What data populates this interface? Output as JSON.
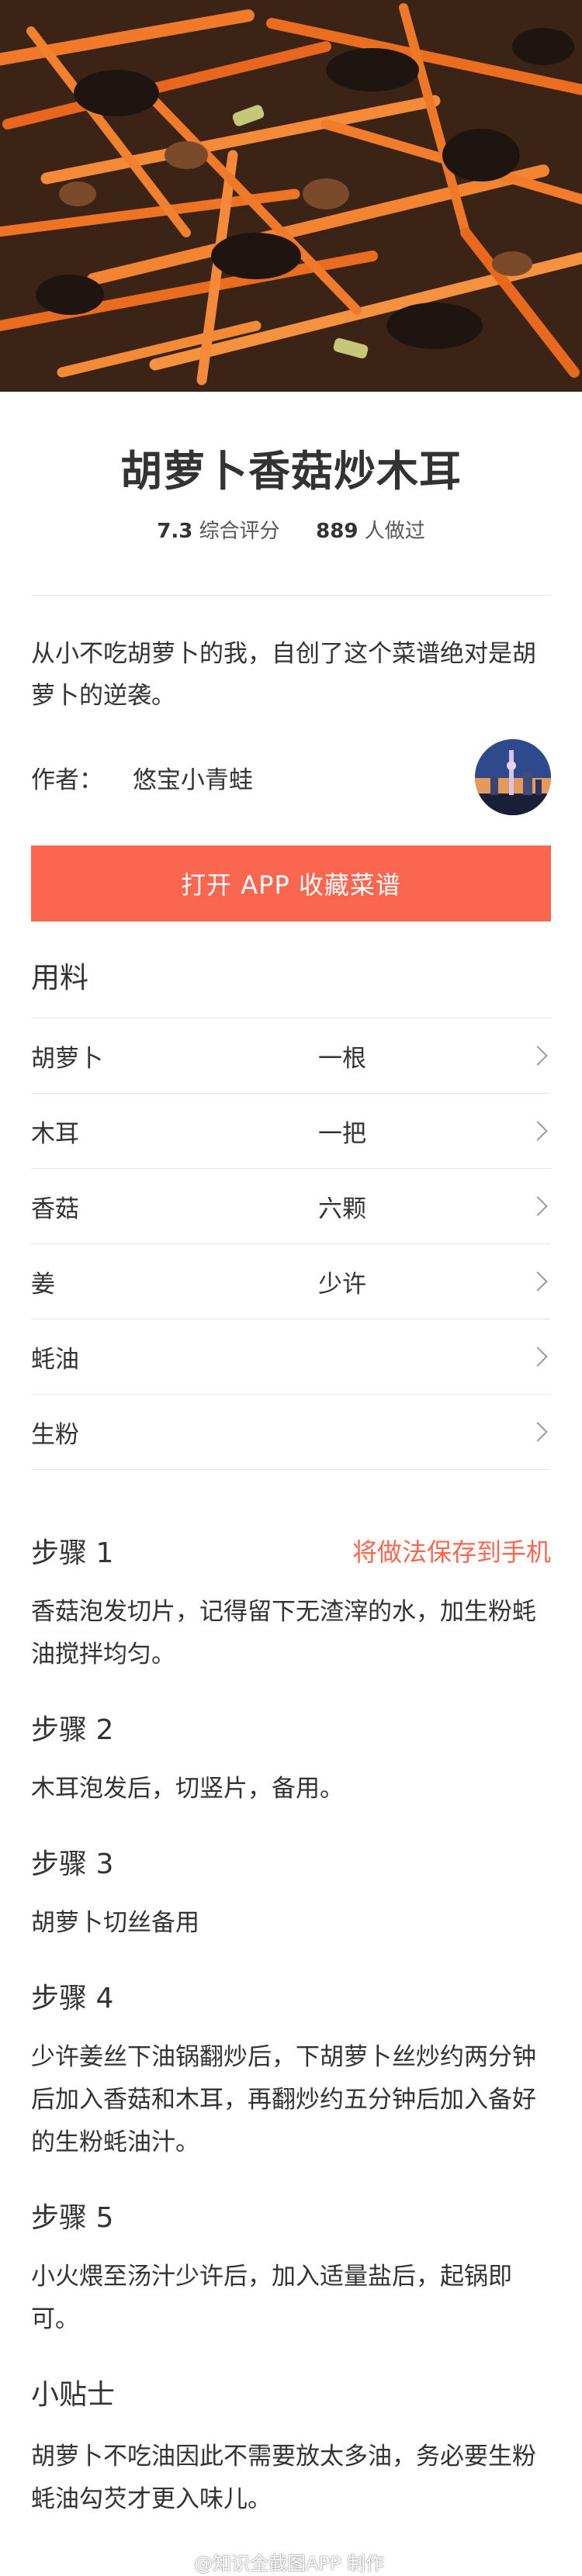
{
  "recipe": {
    "title": "胡萝卜香菇炒木耳",
    "rating_value": "7.3",
    "rating_label": "综合评分",
    "made_count": "889",
    "made_label": "人做过",
    "description": "从小不吃胡萝卜的我，自创了这个菜谱绝对是胡萝卜的逆袭。",
    "author_label": "作者：",
    "author_name": "悠宝小青蛙"
  },
  "app_button_label": "打开 APP 收藏菜谱",
  "ingredients": {
    "title": "用料",
    "items": [
      {
        "name": "胡萝卜",
        "qty": "一根"
      },
      {
        "name": "木耳",
        "qty": "一把"
      },
      {
        "name": "香菇",
        "qty": "六颗"
      },
      {
        "name": "姜",
        "qty": "少许"
      },
      {
        "name": "蚝油",
        "qty": ""
      },
      {
        "name": "生粉",
        "qty": ""
      }
    ]
  },
  "steps": {
    "save_link": "将做法保存到手机",
    "items": [
      {
        "title": "步骤 1",
        "text": "香菇泡发切片，记得留下无渣滓的水，加生粉蚝油搅拌均匀。"
      },
      {
        "title": "步骤 2",
        "text": "木耳泡发后，切竖片，备用。"
      },
      {
        "title": "步骤 3",
        "text": "胡萝卜切丝备用"
      },
      {
        "title": "步骤 4",
        "text": "少许姜丝下油锅翻炒后，下胡萝卜丝炒约两分钟后加入香菇和木耳，再翻炒约五分钟后加入备好的生粉蚝油汁。"
      },
      {
        "title": "步骤 5",
        "text": "小火煨至汤汁少许后，加入适量盐后，起锅即可。"
      }
    ]
  },
  "tips": {
    "title": "小贴士",
    "text": "胡萝卜不吃油因此不需要放太多油，务必要生粉蚝油勾芡才更入味儿。"
  },
  "watermark": "@知识全截图APP 制作",
  "icons": {
    "chevron": "chevron-right-icon"
  },
  "colors": {
    "accent": "#fa6650",
    "text": "#333333",
    "divider": "#e6e6e6"
  }
}
